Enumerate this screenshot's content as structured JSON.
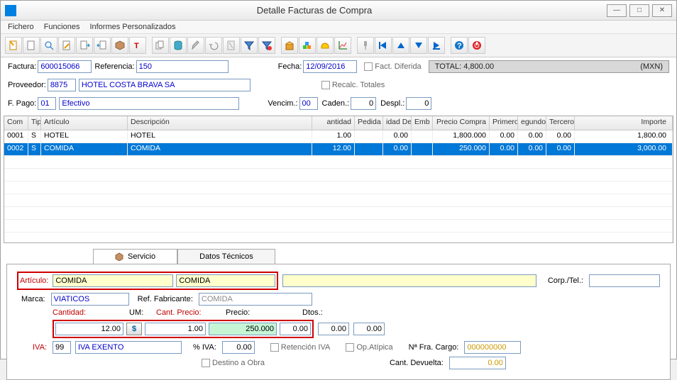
{
  "window": {
    "title": "Detalle Facturas de Compra"
  },
  "menu": {
    "fichero": "Fichero",
    "funciones": "Funciones",
    "informes": "Informes Personalizados"
  },
  "header": {
    "factura_lbl": "Factura:",
    "factura": "600015066",
    "referencia_lbl": "Referencia:",
    "referencia": "150",
    "fecha_lbl": "Fecha:",
    "fecha": "12/09/2016",
    "fact_diferida": "Fact. Diferida",
    "total_lbl": "TOTAL:",
    "total": "4,800.00",
    "currency": "(MXN)",
    "proveedor_lbl": "Proveedor:",
    "proveedor_cod": "8875",
    "proveedor_nom": "HOTEL COSTA BRAVA SA",
    "recalc": "Recalc. Totales",
    "fpago_lbl": "F. Pago:",
    "fpago_cod": "01",
    "fpago_nom": "Efectivo",
    "vencim_lbl": "Vencim.:",
    "vencim": "00",
    "caden_lbl": "Caden.:",
    "caden": "0",
    "despl_lbl": "Despl.:",
    "despl": "0"
  },
  "grid": {
    "cols": {
      "com": "Com",
      "tip": "Tip",
      "art": "Artículo",
      "desc": "Descripción",
      "cant": "antidad",
      "ped": "Pedida",
      "dev": "idad Devuelta",
      "emb": "Emb",
      "prc": "Precio Compra",
      "p1": "Primero",
      "p2": "egundo",
      "p3": "Tercero",
      "imp": "Importe"
    },
    "rows": [
      {
        "com": "0001",
        "tip": "S",
        "art": "HOTEL",
        "desc": "HOTEL",
        "cant": "1.00",
        "ped": "",
        "dev": "0.00",
        "emb": "",
        "prc": "1,800.000",
        "p1": "0.00",
        "p2": "0.00",
        "p3": "0.00",
        "imp": "1,800.00"
      },
      {
        "com": "0002",
        "tip": "S",
        "art": "COMIDA",
        "desc": "COMIDA",
        "cant": "12.00",
        "ped": "",
        "dev": "0.00",
        "emb": "",
        "prc": "250.000",
        "p1": "0.00",
        "p2": "0.00",
        "p3": "0.00",
        "imp": "3,000.00"
      }
    ]
  },
  "tabs": {
    "servicio": "Servicio",
    "datos": "Datos Técnicos"
  },
  "detail": {
    "articulo_lbl": "Artículo:",
    "articulo_cod": "COMIDA",
    "articulo_desc": "COMIDA",
    "corp_lbl": "Corp./Tel.:",
    "marca_lbl": "Marca:",
    "marca": "VIATICOS",
    "reffab_lbl": "Ref. Fabricante:",
    "reffab": "COMIDA",
    "cantidad_lbl": "Cantidad:",
    "um_lbl": "UM:",
    "cantprecio_lbl": "Cant. Precio:",
    "precio_lbl": "Precio:",
    "dtos_lbl": "Dtos.:",
    "cantidad": "12.00",
    "um": "$",
    "cantprecio": "1.00",
    "precio": "250.000",
    "d1": "0.00",
    "d2": "0.00",
    "d3": "0.00",
    "iva_lbl": "IVA:",
    "iva_cod": "99",
    "iva_nom": "IVA EXENTO",
    "pct_iva_lbl": "% IVA:",
    "pct_iva": "0.00",
    "ret_iva": "Retención IVA",
    "op_atipica": "Op.Atípica",
    "nfra_lbl": "Nª Fra. Cargo:",
    "nfra": "000000000",
    "destino": "Destino a Obra",
    "cant_dev_lbl": "Cant. Devuelta:",
    "cant_dev": "0.00"
  }
}
